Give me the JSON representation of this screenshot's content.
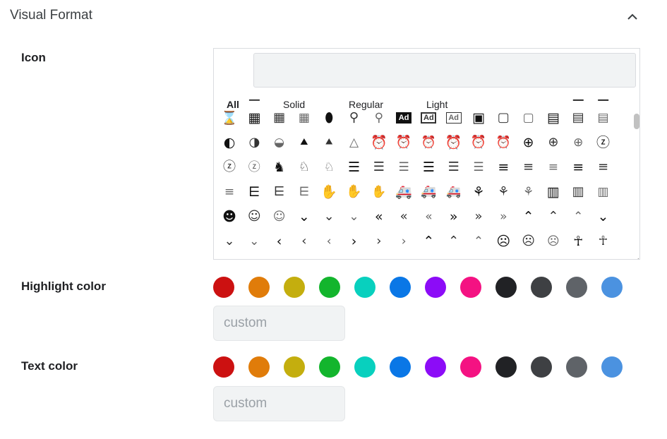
{
  "section": {
    "title": "Visual Format",
    "collapse_icon": "chevron-up-icon"
  },
  "icon_field": {
    "label": "Icon",
    "search_value": "",
    "tabs": [
      {
        "label": "All",
        "active": true
      },
      {
        "label": "Solid",
        "active": false
      },
      {
        "label": "Regular",
        "active": false
      },
      {
        "label": "Light",
        "active": false
      }
    ],
    "icon_rows": [
      [
        {
          "g": "▬",
          "n": "partial-solid-icon",
          "s": "solid"
        },
        {
          "g": "▃",
          "n": "partial-bar-icon",
          "s": "solid"
        },
        {
          "g": "◉",
          "n": "partial-target-icon",
          "s": "solid"
        },
        {
          "g": "◎",
          "n": "partial-target-icon",
          "s": "regular"
        },
        {
          "g": "◌",
          "n": "partial-target-icon",
          "s": "light"
        },
        {
          "g": "▆",
          "n": "partial-solid-icon",
          "s": "solid"
        },
        {
          "g": "▭",
          "n": "partial-outline-icon",
          "s": "regular"
        },
        {
          "g": "▭",
          "n": "partial-outline-icon",
          "s": "light"
        },
        {
          "g": "▀",
          "n": "partial-bar-icon",
          "s": "solid"
        },
        {
          "g": "▔",
          "n": "partial-bar-icon",
          "s": "regular"
        },
        {
          "g": "▔",
          "n": "partial-bar-icon",
          "s": "light"
        },
        {
          "g": "⚯",
          "n": "partial-glasses-icon",
          "s": "solid"
        },
        {
          "g": "⚯",
          "n": "partial-glasses-icon",
          "s": "regular"
        },
        {
          "g": "⚯",
          "n": "partial-glasses-icon",
          "s": "light"
        },
        {
          "g": "▟",
          "n": "partial-solid-icon",
          "s": "solid"
        },
        {
          "g": "▙",
          "n": "partial-solid-icon",
          "s": "solid"
        }
      ],
      [
        {
          "g": "⌛",
          "n": "hourglass-icon",
          "s": "solid"
        },
        {
          "g": "▦",
          "n": "abacus-icon",
          "s": "solid"
        },
        {
          "g": "▦",
          "n": "abacus-icon",
          "s": "regular"
        },
        {
          "g": "▦",
          "n": "abacus-icon",
          "s": "light"
        },
        {
          "g": "⬮",
          "n": "acorn-icon",
          "s": "solid"
        },
        {
          "g": "⚲",
          "n": "acorn-icon",
          "s": "regular"
        },
        {
          "g": "⚲",
          "n": "acorn-icon",
          "s": "light"
        },
        {
          "g": "Ad",
          "n": "ad-icon",
          "s": "solid"
        },
        {
          "g": "Ad",
          "n": "ad-icon",
          "s": "regular"
        },
        {
          "g": "Ad",
          "n": "ad-icon",
          "s": "light"
        },
        {
          "g": "▣",
          "n": "address-book-icon",
          "s": "solid"
        },
        {
          "g": "▢",
          "n": "address-book-icon",
          "s": "regular"
        },
        {
          "g": "▢",
          "n": "address-book-icon",
          "s": "light"
        },
        {
          "g": "▤",
          "n": "address-card-icon",
          "s": "solid"
        },
        {
          "g": "▤",
          "n": "address-card-icon",
          "s": "regular"
        },
        {
          "g": "▤",
          "n": "address-card-icon",
          "s": "light"
        }
      ],
      [
        {
          "g": "◐",
          "n": "adjust-icon",
          "s": "solid"
        },
        {
          "g": "◑",
          "n": "adjust-icon",
          "s": "regular"
        },
        {
          "g": "◒",
          "n": "adjust-icon",
          "s": "light"
        },
        {
          "g": "⯅",
          "n": "tree-icon",
          "s": "solid"
        },
        {
          "g": "⯅",
          "n": "tree-icon",
          "s": "regular"
        },
        {
          "g": "△",
          "n": "tree-icon",
          "s": "light"
        },
        {
          "g": "⏰",
          "n": "alarm-clock-icon",
          "s": "solid"
        },
        {
          "g": "⏰",
          "n": "alarm-clock-icon",
          "s": "regular"
        },
        {
          "g": "⏰",
          "n": "alarm-clock-icon",
          "s": "light"
        },
        {
          "g": "⏰",
          "n": "alarm-exclamation-icon",
          "s": "solid"
        },
        {
          "g": "⏰",
          "n": "alarm-exclamation-icon",
          "s": "regular"
        },
        {
          "g": "⏰",
          "n": "alarm-exclamation-icon",
          "s": "light"
        },
        {
          "g": "⊕",
          "n": "alarm-plus-icon",
          "s": "solid"
        },
        {
          "g": "⊕",
          "n": "alarm-plus-icon",
          "s": "regular"
        },
        {
          "g": "⊕",
          "n": "alarm-plus-icon",
          "s": "light"
        },
        {
          "g": "ⓩ",
          "n": "alarm-snooze-icon",
          "s": "solid"
        }
      ],
      [
        {
          "g": "ⓩ",
          "n": "alarm-snooze-icon",
          "s": "regular"
        },
        {
          "g": "ⓩ",
          "n": "alarm-snooze-icon",
          "s": "light"
        },
        {
          "g": "♞",
          "n": "unicorn-icon",
          "s": "solid"
        },
        {
          "g": "♘",
          "n": "unicorn-icon",
          "s": "regular"
        },
        {
          "g": "♘",
          "n": "unicorn-icon",
          "s": "light"
        },
        {
          "g": "☰",
          "n": "align-center-icon",
          "s": "solid"
        },
        {
          "g": "☰",
          "n": "align-center-icon",
          "s": "regular"
        },
        {
          "g": "☰",
          "n": "align-center-icon",
          "s": "light"
        },
        {
          "g": "☰",
          "n": "align-justify-icon",
          "s": "solid"
        },
        {
          "g": "☰",
          "n": "align-justify-icon",
          "s": "regular"
        },
        {
          "g": "☰",
          "n": "align-justify-icon",
          "s": "light"
        },
        {
          "g": "≡",
          "n": "align-left-icon",
          "s": "solid"
        },
        {
          "g": "≡",
          "n": "align-left-icon",
          "s": "regular"
        },
        {
          "g": "≡",
          "n": "align-left-icon",
          "s": "light"
        },
        {
          "g": "≡",
          "n": "align-right-icon",
          "s": "solid"
        },
        {
          "g": "≡",
          "n": "align-right-icon",
          "s": "regular"
        }
      ],
      [
        {
          "g": "≡",
          "n": "align-right-icon",
          "s": "light"
        },
        {
          "g": "⋿",
          "n": "align-slash-icon",
          "s": "solid"
        },
        {
          "g": "⋿",
          "n": "align-slash-icon",
          "s": "regular"
        },
        {
          "g": "⋿",
          "n": "align-slash-icon",
          "s": "light"
        },
        {
          "g": "✋",
          "n": "allergies-icon",
          "s": "solid"
        },
        {
          "g": "✋",
          "n": "allergies-icon",
          "s": "regular"
        },
        {
          "g": "✋",
          "n": "allergies-icon",
          "s": "light"
        },
        {
          "g": "🚑",
          "n": "ambulance-icon",
          "s": "solid"
        },
        {
          "g": "🚑",
          "n": "ambulance-icon",
          "s": "regular"
        },
        {
          "g": "🚑",
          "n": "ambulance-icon",
          "s": "light"
        },
        {
          "g": "⚘",
          "n": "american-sign-language-icon",
          "s": "solid"
        },
        {
          "g": "⚘",
          "n": "american-sign-language-icon",
          "s": "regular"
        },
        {
          "g": "⚘",
          "n": "american-sign-language-icon",
          "s": "light"
        },
        {
          "g": "▥",
          "n": "analytics-icon",
          "s": "solid"
        },
        {
          "g": "▥",
          "n": "analytics-icon",
          "s": "regular"
        },
        {
          "g": "▥",
          "n": "analytics-icon",
          "s": "light"
        }
      ],
      [
        {
          "g": "☻",
          "n": "angel-icon",
          "s": "solid"
        },
        {
          "g": "☺",
          "n": "angel-icon",
          "s": "regular"
        },
        {
          "g": "☺",
          "n": "angel-icon",
          "s": "light"
        },
        {
          "g": "⌄",
          "n": "angle-double-down-icon",
          "s": "solid"
        },
        {
          "g": "⌄",
          "n": "angle-double-down-icon",
          "s": "regular"
        },
        {
          "g": "⌄",
          "n": "angle-double-down-icon",
          "s": "light"
        },
        {
          "g": "«",
          "n": "angle-double-left-icon",
          "s": "solid"
        },
        {
          "g": "«",
          "n": "angle-double-left-icon",
          "s": "regular"
        },
        {
          "g": "«",
          "n": "angle-double-left-icon",
          "s": "light"
        },
        {
          "g": "»",
          "n": "angle-double-right-icon",
          "s": "solid"
        },
        {
          "g": "»",
          "n": "angle-double-right-icon",
          "s": "regular"
        },
        {
          "g": "»",
          "n": "angle-double-right-icon",
          "s": "light"
        },
        {
          "g": "⌃",
          "n": "angle-double-up-icon",
          "s": "solid"
        },
        {
          "g": "⌃",
          "n": "angle-double-up-icon",
          "s": "regular"
        },
        {
          "g": "⌃",
          "n": "angle-double-up-icon",
          "s": "light"
        },
        {
          "g": "⌄",
          "n": "angle-down-icon",
          "s": "solid"
        }
      ],
      [
        {
          "g": "⌄",
          "n": "angle-down-icon",
          "s": "regular"
        },
        {
          "g": "⌄",
          "n": "angle-down-icon",
          "s": "light"
        },
        {
          "g": "‹",
          "n": "angle-left-icon",
          "s": "solid"
        },
        {
          "g": "‹",
          "n": "angle-left-icon",
          "s": "regular"
        },
        {
          "g": "‹",
          "n": "angle-left-icon",
          "s": "light"
        },
        {
          "g": "›",
          "n": "angle-right-icon",
          "s": "solid"
        },
        {
          "g": "›",
          "n": "angle-right-icon",
          "s": "regular"
        },
        {
          "g": "›",
          "n": "angle-right-icon",
          "s": "light"
        },
        {
          "g": "⌃",
          "n": "angle-up-icon",
          "s": "solid"
        },
        {
          "g": "⌃",
          "n": "angle-up-icon",
          "s": "regular"
        },
        {
          "g": "⌃",
          "n": "angle-up-icon",
          "s": "light"
        },
        {
          "g": "☹",
          "n": "angry-icon",
          "s": "solid"
        },
        {
          "g": "☹",
          "n": "angry-icon",
          "s": "regular"
        },
        {
          "g": "☹",
          "n": "angry-icon",
          "s": "light"
        },
        {
          "g": "☥",
          "n": "ankh-icon",
          "s": "solid"
        },
        {
          "g": "☥",
          "n": "ankh-icon",
          "s": "regular"
        }
      ]
    ]
  },
  "highlight_color": {
    "label": "Highlight color",
    "custom_placeholder": "custom",
    "swatches": [
      "#cc1111",
      "#e07c0a",
      "#c4ae0e",
      "#13b52d",
      "#08d0be",
      "#0a77e6",
      "#8c0cf7",
      "#f41282",
      "#212225",
      "#3e4043",
      "#5f6368",
      "#4b92e0"
    ]
  },
  "text_color": {
    "label": "Text color",
    "custom_placeholder": "custom",
    "swatches": [
      "#cc1111",
      "#e07c0a",
      "#c4ae0e",
      "#13b52d",
      "#08d0be",
      "#0a77e6",
      "#8c0cf7",
      "#f41282",
      "#212225",
      "#3e4043",
      "#5f6368",
      "#4b92e0"
    ]
  }
}
